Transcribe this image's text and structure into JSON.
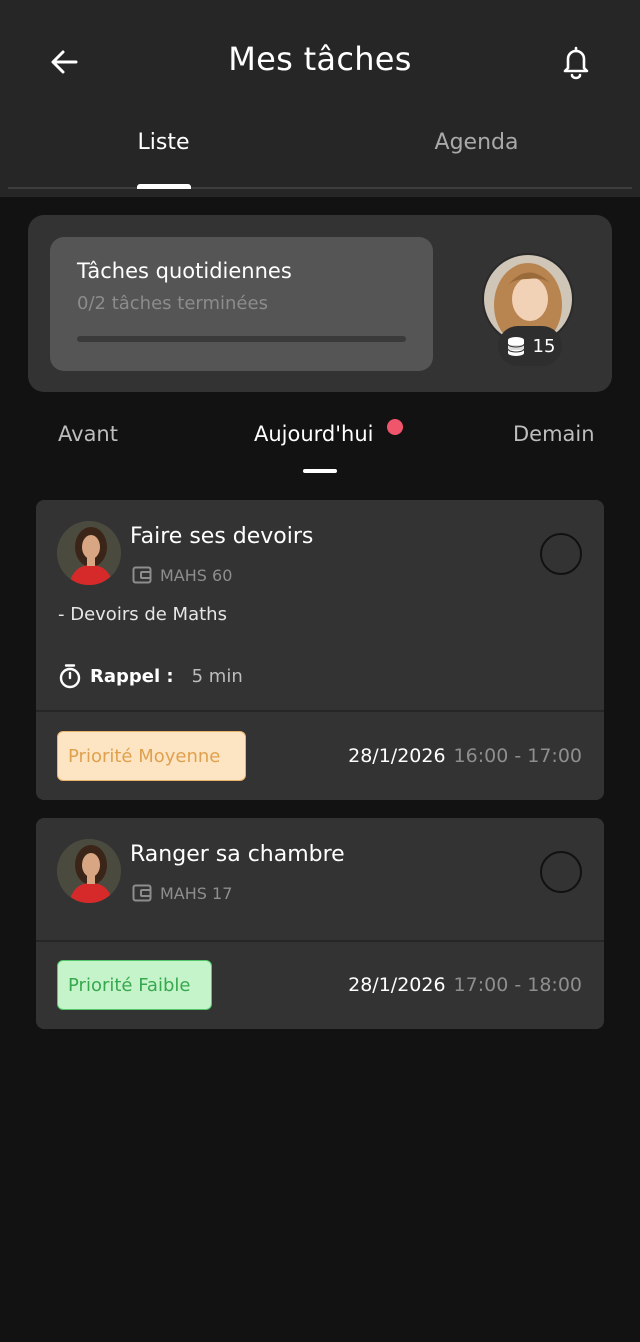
{
  "header": {
    "title": "Mes tâches",
    "back_icon": "arrow-left-icon",
    "bell_icon": "bell-icon"
  },
  "tabs": {
    "liste": "Liste",
    "agenda": "Agenda",
    "active": "Liste"
  },
  "summary": {
    "title": "Tâches quotidiennes",
    "subtitle": "0/2 tâches terminées",
    "progress": 0,
    "coins": "15",
    "coin_icon": "coin-stack-icon"
  },
  "day_tabs": {
    "before": "Avant",
    "today": "Aujourd'hui",
    "after": "Demain",
    "active": "Aujourd'hui"
  },
  "tasks": [
    {
      "title": "Faire ses devoirs",
      "code": "MAHS 60",
      "description": "- Devoirs de Maths",
      "reminder_label": "Rappel :",
      "reminder_value": "5 min",
      "priority": "Priorité Moyenne",
      "date": "28/1/2026",
      "time": "16:00 - 17:00"
    },
    {
      "title": "Ranger sa chambre",
      "code": "MAHS 17",
      "priority": "Priorité Faible",
      "date": "28/1/2026",
      "time": "17:00 - 18:00"
    }
  ],
  "colors": {
    "background": "#121212",
    "header": "#262626",
    "card": "#333333",
    "notification_dot": "#f0566b",
    "priority_medium": "#e0a14e",
    "priority_low": "#37a84d"
  }
}
